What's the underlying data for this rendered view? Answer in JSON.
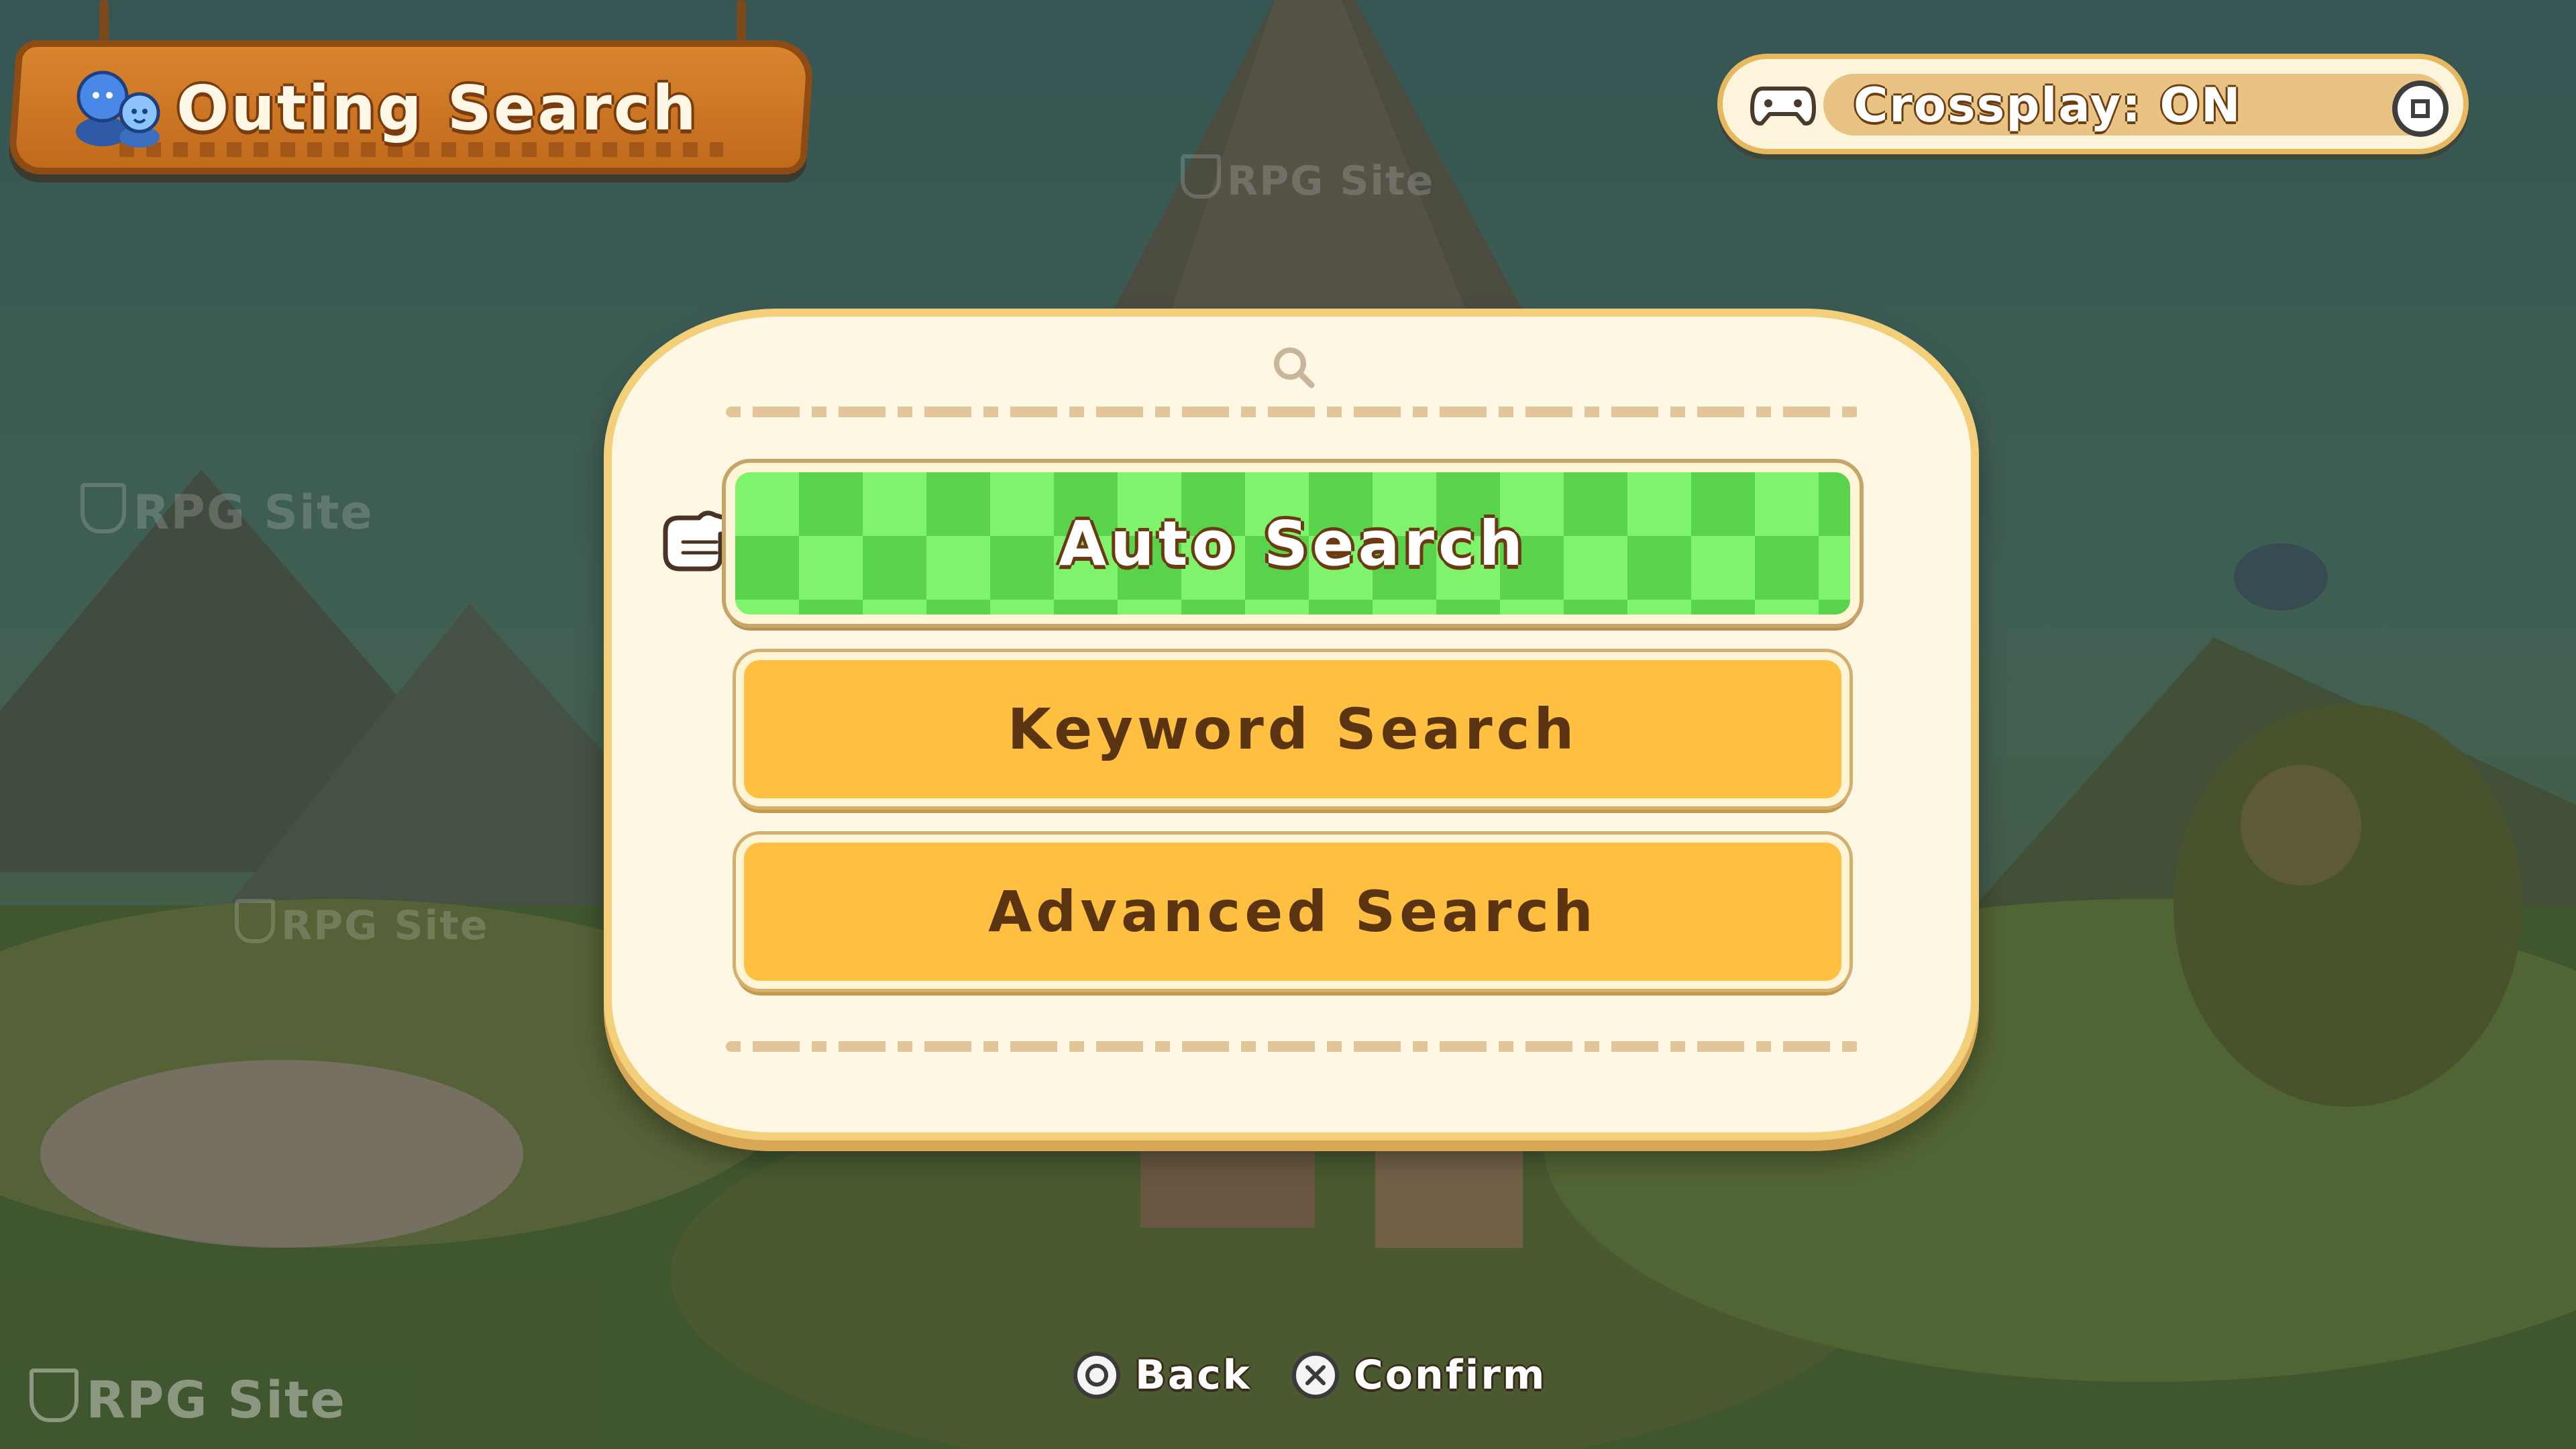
{
  "header": {
    "title": "Outing Search",
    "title_icon": "two-people-icon"
  },
  "crossplay": {
    "icon": "gamepad-icon",
    "label": "Crossplay: ON",
    "toggle_button": "square-button-icon"
  },
  "search_panel": {
    "icon": "magnifier-icon",
    "pointer_icon": "pointing-hand-icon",
    "options": [
      {
        "label": "Auto Search",
        "selected": true
      },
      {
        "label": "Keyword Search",
        "selected": false
      },
      {
        "label": "Advanced Search",
        "selected": false
      }
    ]
  },
  "footer": {
    "back": {
      "button": "circle-button-icon",
      "label": "Back"
    },
    "confirm": {
      "button": "cross-button-icon",
      "label": "Confirm"
    }
  },
  "watermarks": [
    "RPG Site",
    "RPG Site",
    "RPG Site",
    "RPG Site"
  ],
  "colors": {
    "selected_green": "#7ef36b",
    "button_yellow": "#ffc041",
    "panel_cream": "#fdf7e4",
    "title_wood": "#d9852e",
    "text_brown": "#5a3410"
  }
}
